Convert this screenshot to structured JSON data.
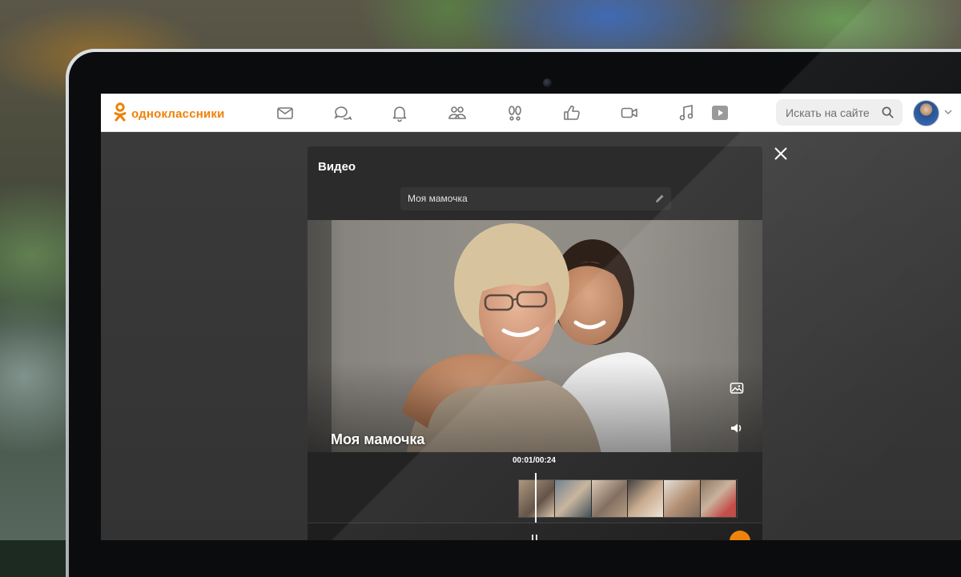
{
  "header": {
    "brand": "одноклассники",
    "brand_color": "#ee8208",
    "nav": [
      {
        "name": "messages",
        "icon": "envelope-icon"
      },
      {
        "name": "discussions",
        "icon": "chat-bubbles-icon"
      },
      {
        "name": "notifications",
        "icon": "bell-icon"
      },
      {
        "name": "friends",
        "icon": "people-icon"
      },
      {
        "name": "guests",
        "icon": "footprints-icon"
      },
      {
        "name": "events",
        "icon": "thumbs-up-icon"
      },
      {
        "name": "video",
        "icon": "video-camera-icon"
      },
      {
        "name": "music",
        "icon": "music-note-icon"
      },
      {
        "name": "showcase",
        "icon": "play-square-icon"
      }
    ],
    "search": {
      "placeholder": "Искать на сайте"
    }
  },
  "modal": {
    "title": "Видео",
    "video_name": "Моя мамочка",
    "caption": "Моя мамочка",
    "time": "00:01/00:24",
    "progress": 0.04,
    "thumbnail_count": 6
  }
}
